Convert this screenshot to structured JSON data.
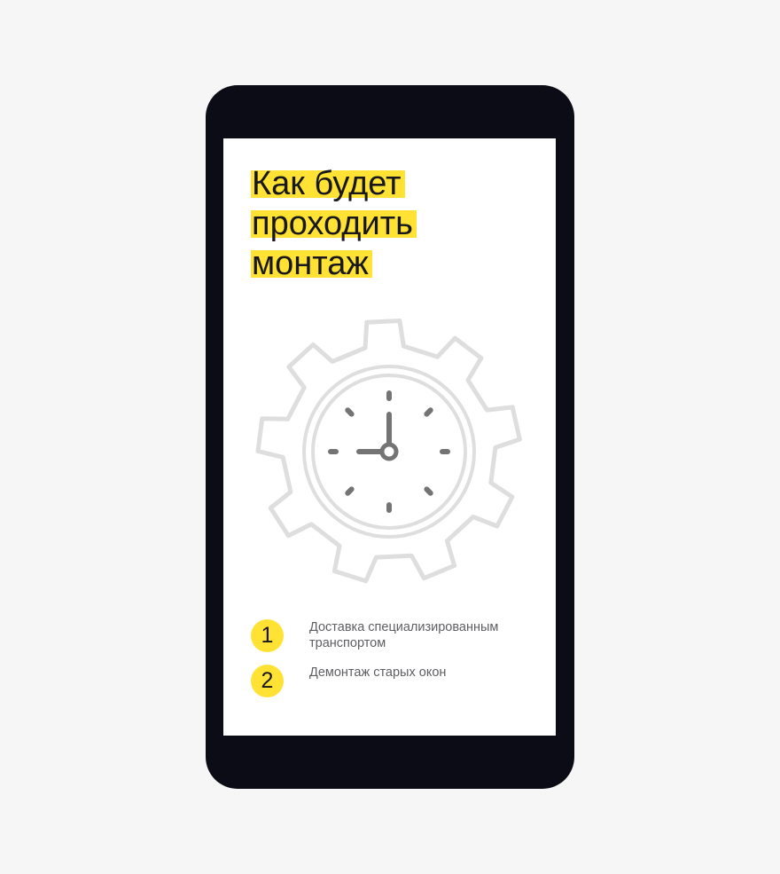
{
  "title_lines": [
    "Как будет",
    "проходить",
    "монтаж"
  ],
  "illustration": {
    "icon": "gear-clock-icon",
    "gear_color": "#dedede",
    "hand_color": "#747474"
  },
  "steps": [
    {
      "number": "1",
      "text": "Доставка специализированным транспортом"
    },
    {
      "number": "2",
      "text": "Демонтаж старых окон"
    }
  ],
  "colors": {
    "background": "#f6f6f6",
    "phone_frame": "#0b0c16",
    "screen": "#ffffff",
    "accent_yellow": "#ffe233",
    "title_text": "#17171c",
    "step_text": "#5e5e63"
  }
}
